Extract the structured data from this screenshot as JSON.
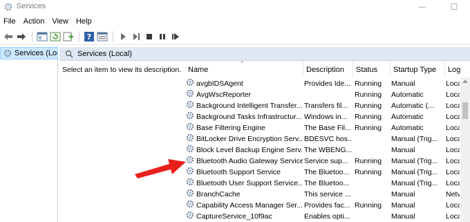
{
  "window": {
    "title": "Services",
    "minimize_glyph": "—",
    "maximize_glyph": "☐",
    "close_glyph": "✕"
  },
  "menu": [
    "File",
    "Action",
    "View",
    "Help"
  ],
  "toolbar": {
    "icons": [
      "back-icon",
      "forward-icon",
      "show-hide-tree-icon",
      "refresh-icon",
      "export-list-icon",
      "help-icon",
      "properties-icon",
      "start-service-icon",
      "play-icon",
      "stop-icon",
      "pause-icon",
      "restart-icon"
    ]
  },
  "tree": {
    "selected_label": "Services (Loca"
  },
  "content_header": {
    "label": "Services (Local)"
  },
  "description_panel": {
    "text": "Select an item to view its description."
  },
  "columns": {
    "name": "Name",
    "description": "Description",
    "status": "Status",
    "startup_type": "Startup Type",
    "log_on_as": "Log"
  },
  "rows": [
    {
      "name": "avgbIDSAgent",
      "description": "Provides Ide...",
      "status": "Running",
      "startup_type": "Manual",
      "log_on_as": "Loca"
    },
    {
      "name": "AvgWscReporter",
      "description": "",
      "status": "Running",
      "startup_type": "Automatic",
      "log_on_as": "Loca"
    },
    {
      "name": "Background Intelligent Transfer...",
      "description": "Transfers fil...",
      "status": "Running",
      "startup_type": "Automatic (...",
      "log_on_as": "Loca"
    },
    {
      "name": "Background Tasks Infrastructur...",
      "description": "Windows in...",
      "status": "Running",
      "startup_type": "Automatic",
      "log_on_as": "Loca"
    },
    {
      "name": "Base Filtering Engine",
      "description": "The Base Fil...",
      "status": "Running",
      "startup_type": "Automatic",
      "log_on_as": "Loca"
    },
    {
      "name": "BitLocker Drive Encryption Serv...",
      "description": "BDESVC hos...",
      "status": "",
      "startup_type": "Manual (Trig...",
      "log_on_as": "Loca"
    },
    {
      "name": "Block Level Backup Engine Serv...",
      "description": "The WBENG...",
      "status": "",
      "startup_type": "Manual",
      "log_on_as": "Loca"
    },
    {
      "name": "Bluetooth Audio Gateway Service",
      "description": "Service sup...",
      "status": "Running",
      "startup_type": "Manual (Trig...",
      "log_on_as": "Loca"
    },
    {
      "name": "Bluetooth Support Service",
      "description": "The Bluetoo...",
      "status": "Running",
      "startup_type": "Manual (Trig...",
      "log_on_as": "Loca"
    },
    {
      "name": "Bluetooth User Support Service...",
      "description": "The Bluetoo...",
      "status": "",
      "startup_type": "Manual (Trig...",
      "log_on_as": "Loca"
    },
    {
      "name": "BranchCache",
      "description": "This service ...",
      "status": "",
      "startup_type": "Manual",
      "log_on_as": "Netv"
    },
    {
      "name": "Capability Access Manager Ser...",
      "description": "Provides fac...",
      "status": "Running",
      "startup_type": "Manual",
      "log_on_as": "Loca"
    },
    {
      "name": "CaptureService_10f9ac",
      "description": "Enables opti...",
      "status": "",
      "startup_type": "Manual",
      "log_on_as": "Loca"
    }
  ],
  "colors": {
    "header_band": "#dfe8f3",
    "tree_selection": "#cce8ff",
    "annotation_arrow": "#e8201c"
  }
}
